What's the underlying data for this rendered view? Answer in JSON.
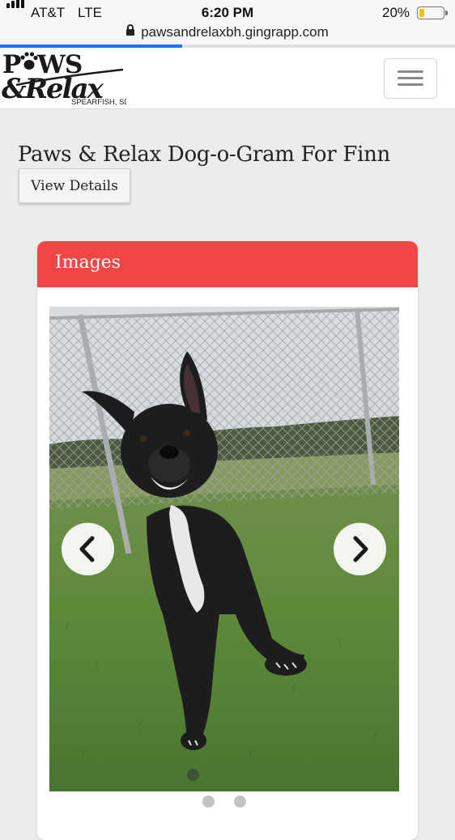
{
  "status_bar": {
    "carrier": "AT&T",
    "network": "LTE",
    "time": "6:20 PM",
    "battery_percent": "20%",
    "battery_level": 0.2
  },
  "browser": {
    "url": "pawsandrelaxbh.gingrapp.com",
    "load_progress": 0.4
  },
  "header": {
    "logo": {
      "line1": "PAWS",
      "line2": "&Relax",
      "location": "SPEARFISH, SD"
    },
    "menu_icon": "hamburger-menu-icon"
  },
  "page": {
    "title": "Paws & Relax Dog-o-Gram For Finn",
    "view_details_label": "View Details"
  },
  "images_card": {
    "title": "Images",
    "header_color": "#f04645",
    "photo_alt": "Black dog with white chest running on grass in front of a chain-link fence",
    "prev_icon": "chevron-left-icon",
    "next_icon": "chevron-right-icon",
    "slide_count": 2,
    "active_slide": 1
  }
}
